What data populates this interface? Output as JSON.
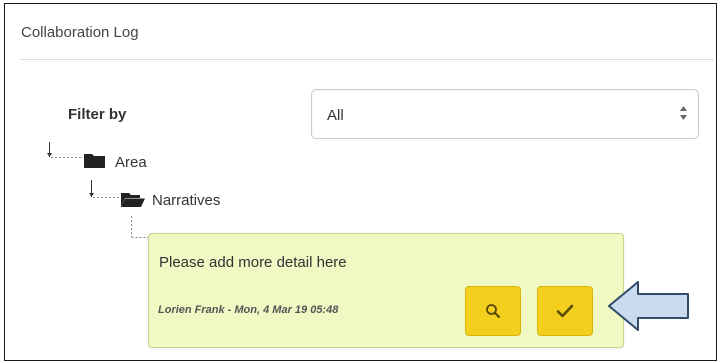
{
  "panel": {
    "title": "Collaboration Log"
  },
  "filter": {
    "label": "Filter by",
    "selected": "All"
  },
  "tree": {
    "area_label": "Area",
    "narratives_label": "Narratives"
  },
  "comment": {
    "text": "Please add more detail here",
    "meta": "Lorien Frank - Mon, 4 Mar 19 05:48"
  },
  "icons": {
    "folder_closed": "folder-icon",
    "folder_open": "folder-open-icon",
    "search": "search-icon",
    "check": "check-icon",
    "pointer": "arrow-left-icon"
  },
  "colors": {
    "comment_bg": "#f0f8c4",
    "button_bg": "#f2ce1d",
    "arrow_fill": "#c9dcef",
    "arrow_stroke": "#2f4d6b"
  }
}
